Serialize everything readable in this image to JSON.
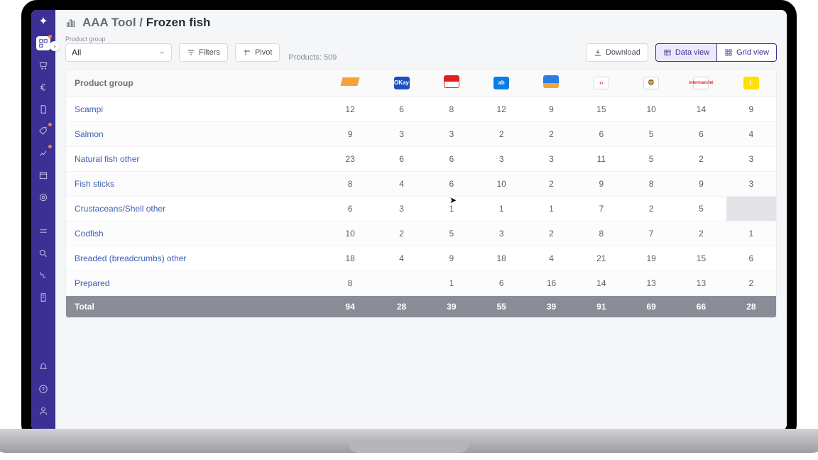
{
  "breadcrumb": {
    "parent": "AAA Tool",
    "sep": "/",
    "current": "Frozen fish"
  },
  "productGroup": {
    "label": "Product group",
    "value": "All"
  },
  "buttons": {
    "filters": "Filters",
    "pivot": "Pivot",
    "download": "Download",
    "dataView": "Data view",
    "gridView": "Grid view"
  },
  "meta": {
    "products": "Products: 509"
  },
  "table": {
    "header": "Product group",
    "brands": [
      "Colruyt",
      "Okay",
      "Spar",
      "AH",
      "Aldi",
      "Carrefour",
      "Delhaize",
      "Intermarché",
      "Lidl"
    ],
    "rows": [
      {
        "name": "Scampi",
        "v": [
          "12",
          "6",
          "8",
          "12",
          "9",
          "15",
          "10",
          "14",
          "9"
        ]
      },
      {
        "name": "Salmon",
        "v": [
          "9",
          "3",
          "3",
          "2",
          "2",
          "6",
          "5",
          "6",
          "4"
        ]
      },
      {
        "name": "Natural fish other",
        "v": [
          "23",
          "6",
          "6",
          "3",
          "3",
          "11",
          "5",
          "2",
          "3"
        ]
      },
      {
        "name": "Fish sticks",
        "v": [
          "8",
          "4",
          "6",
          "10",
          "2",
          "9",
          "8",
          "9",
          "3"
        ]
      },
      {
        "name": "Crustaceans/Shell other",
        "v": [
          "6",
          "3",
          "1",
          "1",
          "1",
          "7",
          "2",
          "5",
          ""
        ]
      },
      {
        "name": "Codfish",
        "v": [
          "10",
          "2",
          "5",
          "3",
          "2",
          "8",
          "7",
          "2",
          "1"
        ]
      },
      {
        "name": "Breaded (breadcrumbs) other",
        "v": [
          "18",
          "4",
          "9",
          "18",
          "4",
          "21",
          "19",
          "15",
          "6"
        ]
      },
      {
        "name": "Prepared",
        "v": [
          "8",
          "",
          "1",
          "6",
          "16",
          "14",
          "13",
          "13",
          "2"
        ]
      }
    ],
    "total": {
      "label": "Total",
      "v": [
        "94",
        "28",
        "39",
        "55",
        "39",
        "91",
        "69",
        "66",
        "28"
      ]
    }
  }
}
